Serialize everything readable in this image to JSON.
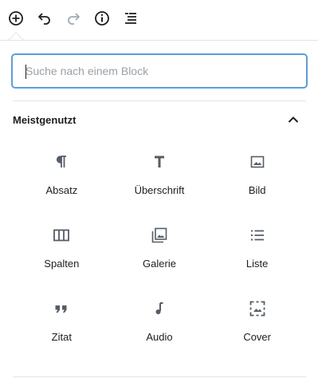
{
  "toolbar": {
    "add": "plus-circle-icon",
    "undo": "undo-icon",
    "redo": "redo-icon",
    "info": "info-icon",
    "outline": "list-view-icon"
  },
  "inserter": {
    "search": {
      "placeholder": "Suche nach einem Block",
      "value": ""
    },
    "panel": {
      "title": "Meistgenutzt",
      "expanded": true
    },
    "blocks": [
      {
        "label": "Absatz",
        "icon": "paragraph-icon"
      },
      {
        "label": "Überschrift",
        "icon": "heading-icon"
      },
      {
        "label": "Bild",
        "icon": "image-icon"
      },
      {
        "label": "Spalten",
        "icon": "columns-icon"
      },
      {
        "label": "Galerie",
        "icon": "gallery-icon"
      },
      {
        "label": "Liste",
        "icon": "list-icon"
      },
      {
        "label": "Zitat",
        "icon": "quote-icon"
      },
      {
        "label": "Audio",
        "icon": "audio-icon"
      },
      {
        "label": "Cover",
        "icon": "cover-icon"
      }
    ]
  },
  "colors": {
    "accent": "#5b9dd9",
    "text": "#1e1e1e",
    "border": "#e2e4e7",
    "disabled": "#a2aab2"
  }
}
